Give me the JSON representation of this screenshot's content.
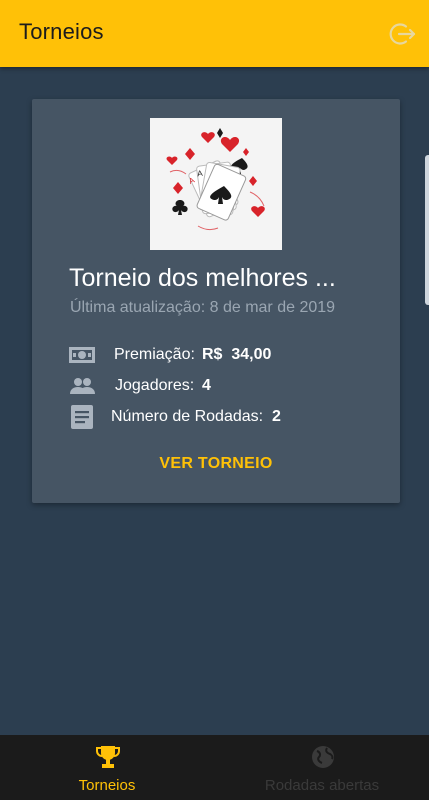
{
  "appbar": {
    "title": "Torneios",
    "logout_icon": "logout-icon"
  },
  "card": {
    "title": "Torneio dos melhores ...",
    "updated": "Última atualização: 8 de mar de 2019",
    "image_icon": "playing-cards-image",
    "prize": {
      "label": "Premiação:",
      "value": "R$  34,00",
      "icon": "money-icon"
    },
    "players": {
      "label": "Jogadores:",
      "value": "4",
      "icon": "people-icon"
    },
    "rounds": {
      "label": "Número de Rodadas:",
      "value": "2",
      "icon": "document-icon"
    },
    "action": "VER TORNEIO"
  },
  "bottom_nav": {
    "items": [
      {
        "label": "Torneios",
        "icon": "trophy-icon",
        "active": true,
        "color": "#ffc107"
      },
      {
        "label": "Rodadas abertas",
        "icon": "globe-icon",
        "active": false,
        "color": "#3a3a3a"
      }
    ]
  },
  "colors": {
    "appbar": "#ffc107",
    "background": "#2c3e50",
    "card": "#465564",
    "accent": "#ffc107",
    "nav_background": "#1b1b1b"
  }
}
